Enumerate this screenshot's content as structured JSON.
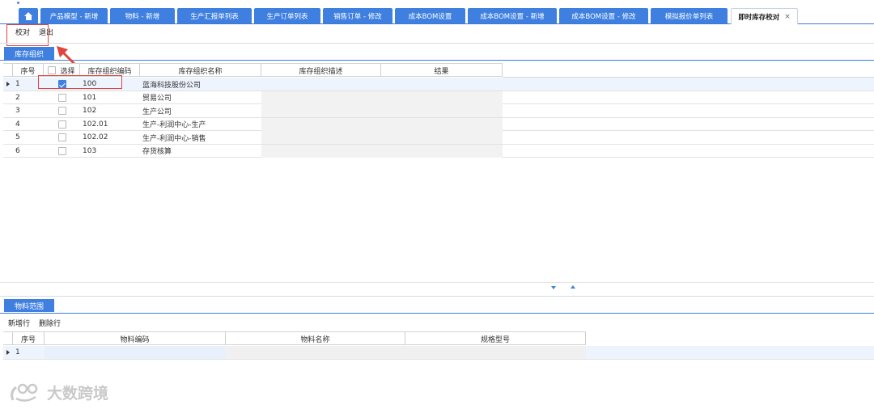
{
  "tabs": [
    {
      "label": "",
      "icon": "home-icon"
    },
    {
      "label": "产品模型 - 新增"
    },
    {
      "label": "物料 - 新增"
    },
    {
      "label": "生产汇报单列表"
    },
    {
      "label": "生产订单列表"
    },
    {
      "label": "销售订单 - 修改"
    },
    {
      "label": "成本BOM设置"
    },
    {
      "label": "成本BOM设置 - 新增"
    },
    {
      "label": "成本BOM设置 - 修改"
    },
    {
      "label": "模拟报价单列表"
    },
    {
      "label": "即时库存校对",
      "active": true,
      "close": "×"
    }
  ],
  "toolbar": {
    "verify_label": "校对",
    "exit_label": "退出"
  },
  "org_section": {
    "tab_label": "库存组织",
    "columns": {
      "seq": "序号",
      "select": "选择",
      "code": "库存组织编码",
      "name": "库存组织名称",
      "desc": "库存组织描述",
      "result": "结果"
    },
    "rows": [
      {
        "seq": "1",
        "checked": true,
        "code": "100",
        "name": "蓝海科技股份公司"
      },
      {
        "seq": "2",
        "checked": false,
        "code": "101",
        "name": "贸易公司"
      },
      {
        "seq": "3",
        "checked": false,
        "code": "102",
        "name": "生产公司"
      },
      {
        "seq": "4",
        "checked": false,
        "code": "102.01",
        "name": "生产-利润中心-生产"
      },
      {
        "seq": "5",
        "checked": false,
        "code": "102.02",
        "name": "生产-利润中心-销售"
      },
      {
        "seq": "6",
        "checked": false,
        "code": "103",
        "name": "存货核算"
      }
    ]
  },
  "material_section": {
    "tab_label": "物料范围",
    "add_row_label": "新增行",
    "delete_row_label": "删除行",
    "columns": {
      "seq": "序号",
      "code": "物料编码",
      "name": "物料名称",
      "spec": "规格型号"
    },
    "rows": [
      {
        "seq": "1"
      }
    ]
  },
  "watermark": {
    "text": "大数跨境"
  },
  "colors": {
    "accent": "#3e7fe0",
    "highlight": "#e0443a"
  }
}
